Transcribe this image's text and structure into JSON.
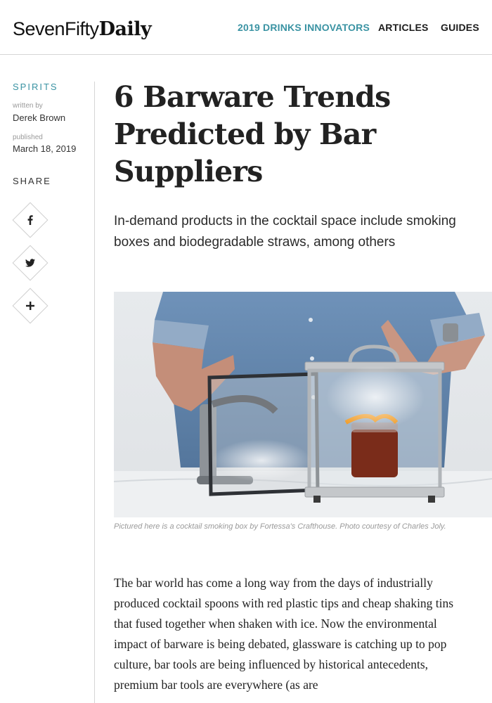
{
  "header": {
    "logo_part1": "SevenFifty",
    "logo_part2": "Daily",
    "nav": [
      {
        "label": "2019 DRINKS INNOVATORS",
        "accent": true
      },
      {
        "label": "ARTICLES",
        "accent": false
      },
      {
        "label": "GUIDES",
        "accent": false
      }
    ]
  },
  "sidebar": {
    "category": "SPIRITS",
    "written_by_label": "written by",
    "author": "Derek Brown",
    "published_label": "published",
    "date": "March 18, 2019",
    "share_label": "SHARE",
    "share_buttons": [
      "facebook-icon",
      "twitter-icon",
      "plus-icon"
    ]
  },
  "article": {
    "title": "6 Barware Trends Predicted by Bar Suppliers",
    "dek": "In-demand products in the cocktail space include smoking boxes and biodegradable straws, among others",
    "caption": "Pictured here is a cocktail smoking box by Fortessa's Crafthouse. Photo courtesy of Charles Joly.",
    "body": "The bar world has come a long way from the days of industrially produced cocktail spoons with red plastic tips and cheap shaking tins that fused together when shaken with ice. Now the environmental impact of barware is being debated, glassware is catching up to pop culture, bar tools are being influenced by historical antecedents, premium bar tools are everywhere (as are"
  },
  "colors": {
    "accent": "#3a93a3",
    "text": "#222222",
    "muted": "#9a9a9a",
    "rule": "#d6d6d6"
  }
}
